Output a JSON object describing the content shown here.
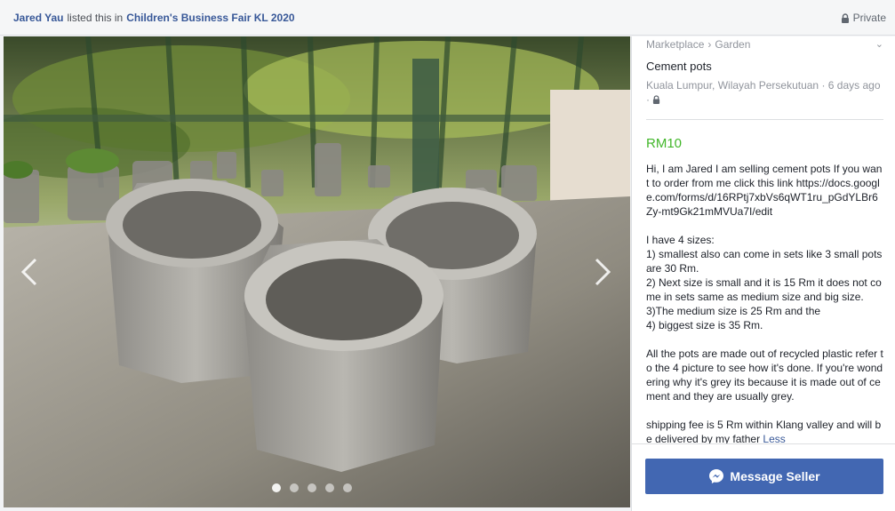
{
  "header": {
    "seller_name": "Jared Yau",
    "listed_text": "listed this in",
    "group_name": "Children's Business Fair KL 2020",
    "privacy_label": "Private"
  },
  "gallery": {
    "photo_count": 5,
    "active_index": 0,
    "icons": [
      "chevron-left-icon",
      "chevron-right-icon"
    ]
  },
  "listing": {
    "breadcrumb": [
      "Marketplace",
      "Garden"
    ],
    "breadcrumb_separator": "›",
    "title": "Cement pots",
    "location": "Kuala Lumpur, Wilayah Persekutuan",
    "time_ago": "6 days ago",
    "price": "RM10",
    "description": "Hi, I am Jared I am selling cement pots If you want to order from me click this link https://docs.google.com/forms/d/16RPtj7xbVs6qWT1ru_pGdYLBr6Zy-mt9Gk21mMVUa7I/edit\n\nI have 4 sizes:\n1) smallest also can come in sets like 3 small pots are 30 Rm.\n2) Next size is small and it is 15 Rm it does not come in sets same as medium size and big size.\n3)The medium size is 25 Rm and the\n4) biggest size is 35 Rm.\n\nAll the pots are made out of recycled plastic refer to the 4 picture to see how it's done. If you're wondering why it's grey its because it is made out of cement and they are usually grey.\n\nshipping fee is 5 Rm within Klang valley and will be delivered by my father",
    "less_label": "Less"
  },
  "actions": {
    "message_label": "Message Seller"
  },
  "colors": {
    "link": "#385898",
    "price": "#42b72a",
    "button": "#4267b2"
  }
}
